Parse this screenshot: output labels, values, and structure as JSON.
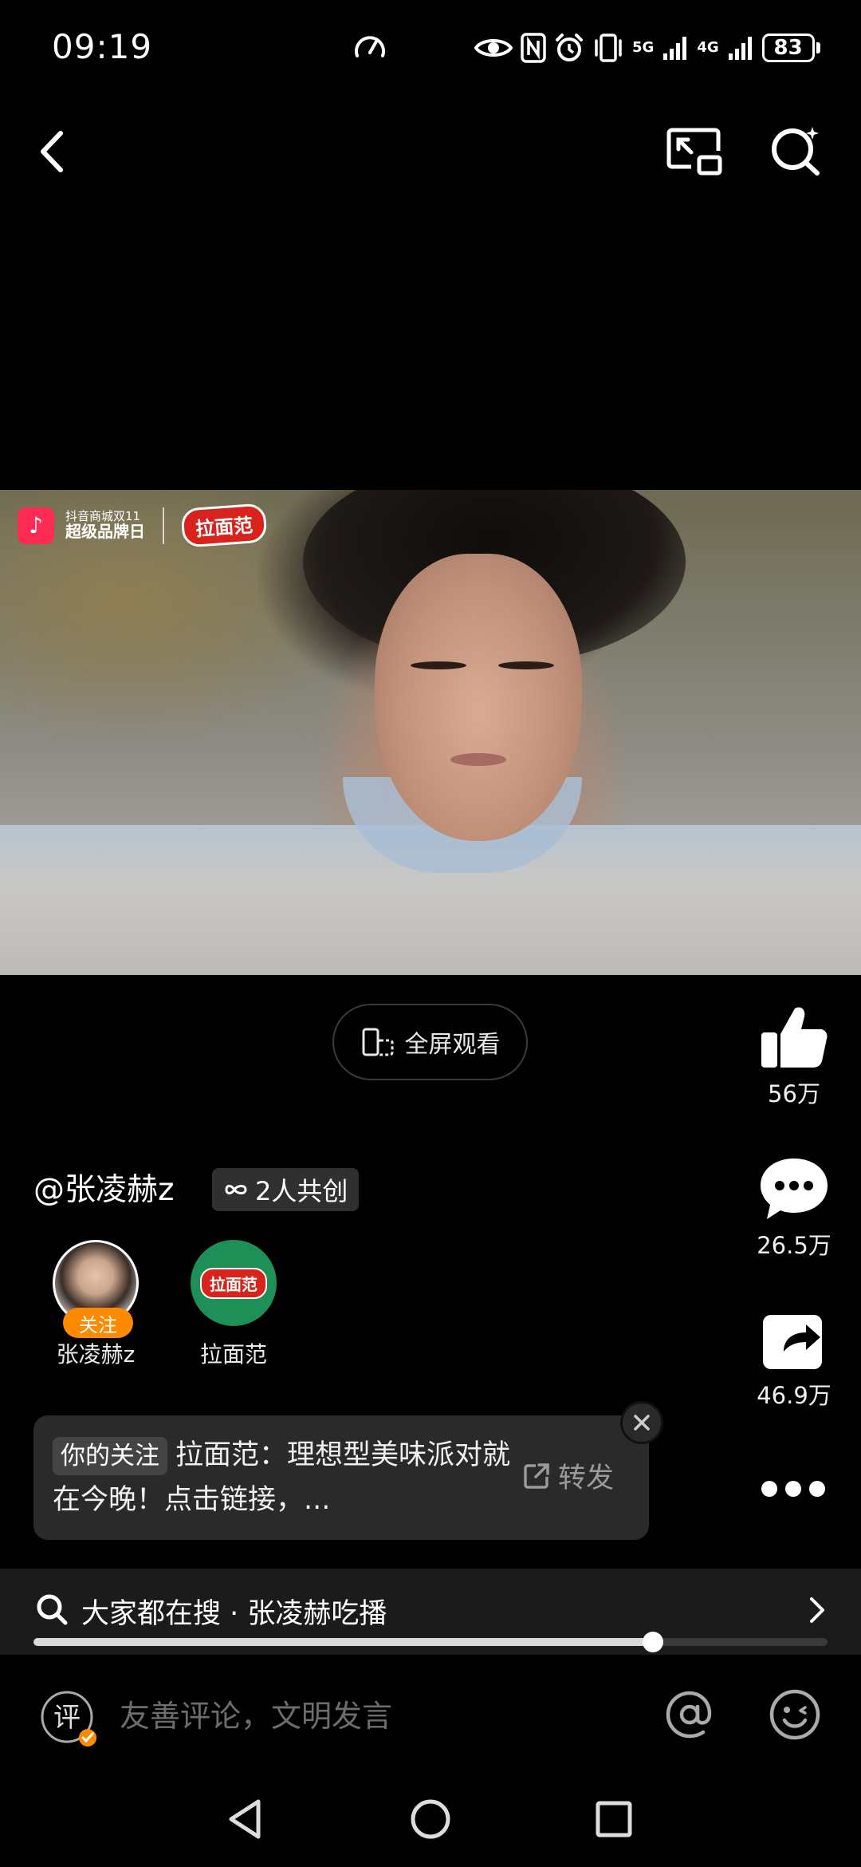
{
  "status_bar": {
    "time": "09:19",
    "network_5g": "5G",
    "network_4g": "4G",
    "battery": "83"
  },
  "video": {
    "brand_small": "抖音商城双11",
    "brand_big": "超级品牌日",
    "brand_logo_text": "拉面范",
    "douyin_logo": "♪"
  },
  "fullscreen": {
    "label": "全屏观看"
  },
  "actions": {
    "like_count": "56万",
    "comment_count": "26.5万",
    "share_count": "46.9万"
  },
  "author": {
    "name": "@张凌赫z",
    "cocreate_label": "2人共创"
  },
  "creators": [
    {
      "name": "张凌赫z",
      "badge": "关注"
    },
    {
      "name": "拉面范",
      "logo_text": "拉面范"
    }
  ],
  "notice": {
    "tag": "你的关注",
    "text": "拉面范：理想型美味派对就在今晚！点击链接，...",
    "forward_label": "转发"
  },
  "search": {
    "text": "大家都在搜 · 张凌赫吃播"
  },
  "progress": {
    "fraction": 0.78
  },
  "comment": {
    "icon_char": "评",
    "placeholder": "友善评论，文明发言"
  },
  "colors": {
    "accent_orange": "#ff8a00",
    "brand_red": "#d8231d",
    "brand_green": "#1f8f58",
    "douyin_red": "#fe2c55"
  }
}
